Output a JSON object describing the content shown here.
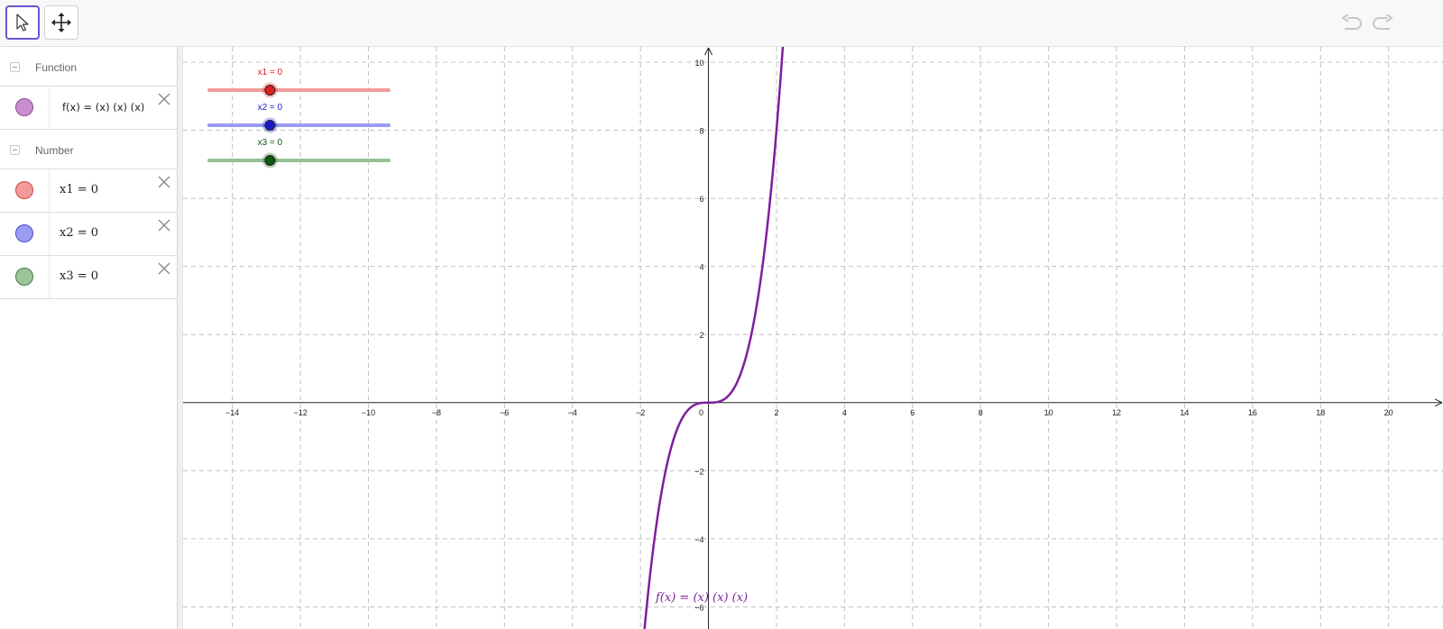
{
  "toolbar": {
    "tools": [
      {
        "name": "move-tool",
        "icon": "arrow-cursor-icon",
        "active": true
      },
      {
        "name": "move-graphics-view-tool",
        "icon": "four-way-arrows-icon",
        "active": false
      }
    ],
    "undo_icon": "undo-icon",
    "redo_icon": "redo-icon"
  },
  "algebra": {
    "categories": [
      {
        "label": "Function",
        "items": [
          {
            "text": "f(x) = (x) (x) (x)",
            "color": "#c98fd0",
            "border": "#8e4a97"
          }
        ]
      },
      {
        "label": "Number",
        "items": [
          {
            "text": "x1 = 0",
            "color": "#f49a9a",
            "border": "#c44a4a"
          },
          {
            "text": "x2 = 0",
            "color": "#9a9cf4",
            "border": "#4a4cc4"
          },
          {
            "text": "x3 = 0",
            "color": "#9bc49b",
            "border": "#4c7a4c"
          }
        ]
      }
    ]
  },
  "graphics": {
    "sliders": [
      {
        "label": "x1 = 0",
        "value": 0,
        "color": "#e02020",
        "track": "#f39b9b",
        "label_color": "#e01818"
      },
      {
        "label": "x2 = 0",
        "value": 0,
        "color": "#1a1acc",
        "track": "#9a9cf2",
        "label_color": "#1a1acc"
      },
      {
        "label": "x3 = 0",
        "value": 0,
        "color": "#0d5a0d",
        "track": "#96c296",
        "label_color": "#0e5a0e"
      }
    ],
    "function_label": "f(x) = (x) (x) (x)",
    "function_color": "#7e1f9e",
    "x_ticks": [
      "−14",
      "−12",
      "−10",
      "−8",
      "−6",
      "−4",
      "−2",
      "0",
      "2",
      "4",
      "6",
      "8",
      "10",
      "12",
      "14",
      "16",
      "18",
      "20"
    ],
    "y_ticks": [
      "10",
      "8",
      "6",
      "4",
      "2",
      "−2",
      "−4",
      "−6"
    ]
  },
  "chart_data": {
    "type": "line",
    "title": "",
    "xlabel": "",
    "ylabel": "",
    "xlim": [
      -15.45,
      21.6
    ],
    "ylim": [
      -6.65,
      10.45
    ],
    "grid": true,
    "x_ticks": [
      -14,
      -12,
      -10,
      -8,
      -6,
      -4,
      -2,
      0,
      2,
      4,
      6,
      8,
      10,
      12,
      14,
      16,
      18,
      20
    ],
    "y_ticks": [
      -6,
      -4,
      -2,
      0,
      2,
      4,
      6,
      8,
      10
    ],
    "series": [
      {
        "expression": "x^3",
        "color": "#7e1f9e"
      }
    ]
  }
}
